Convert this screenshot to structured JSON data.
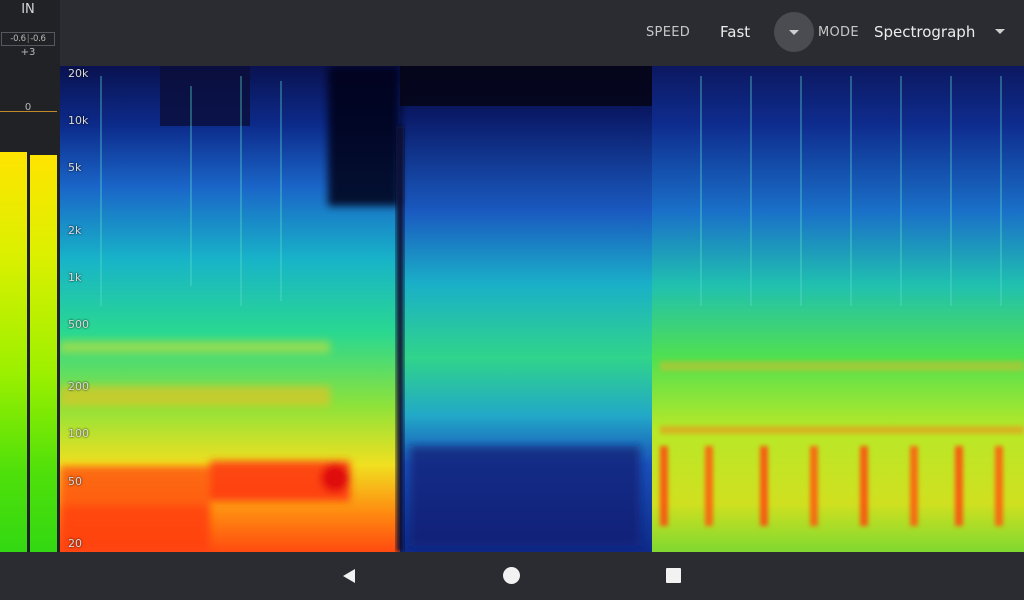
{
  "meter": {
    "title": "IN",
    "peak_left": "-0.6",
    "peak_separator": "|",
    "peak_right": "-0.6",
    "scale_plus3": "+3",
    "scale_zero": "0",
    "level_left_percent": 72.5,
    "level_right_percent": 72.0
  },
  "toolbar": {
    "speed_label": "SPEED",
    "speed_value": "Fast",
    "mode_label": "MODE",
    "mode_value": "Spectrograph"
  },
  "spectrogram": {
    "freq_labels": [
      "20k",
      "10k",
      "5k",
      "2k",
      "1k",
      "500",
      "200",
      "100",
      "50",
      "20"
    ]
  },
  "icons": {
    "speed_dropdown": "chevron-down-icon",
    "mode_dropdown": "chevron-down-icon",
    "nav_back": "back-triangle-icon",
    "nav_home": "home-circle-icon",
    "nav_recents": "recents-square-icon"
  }
}
